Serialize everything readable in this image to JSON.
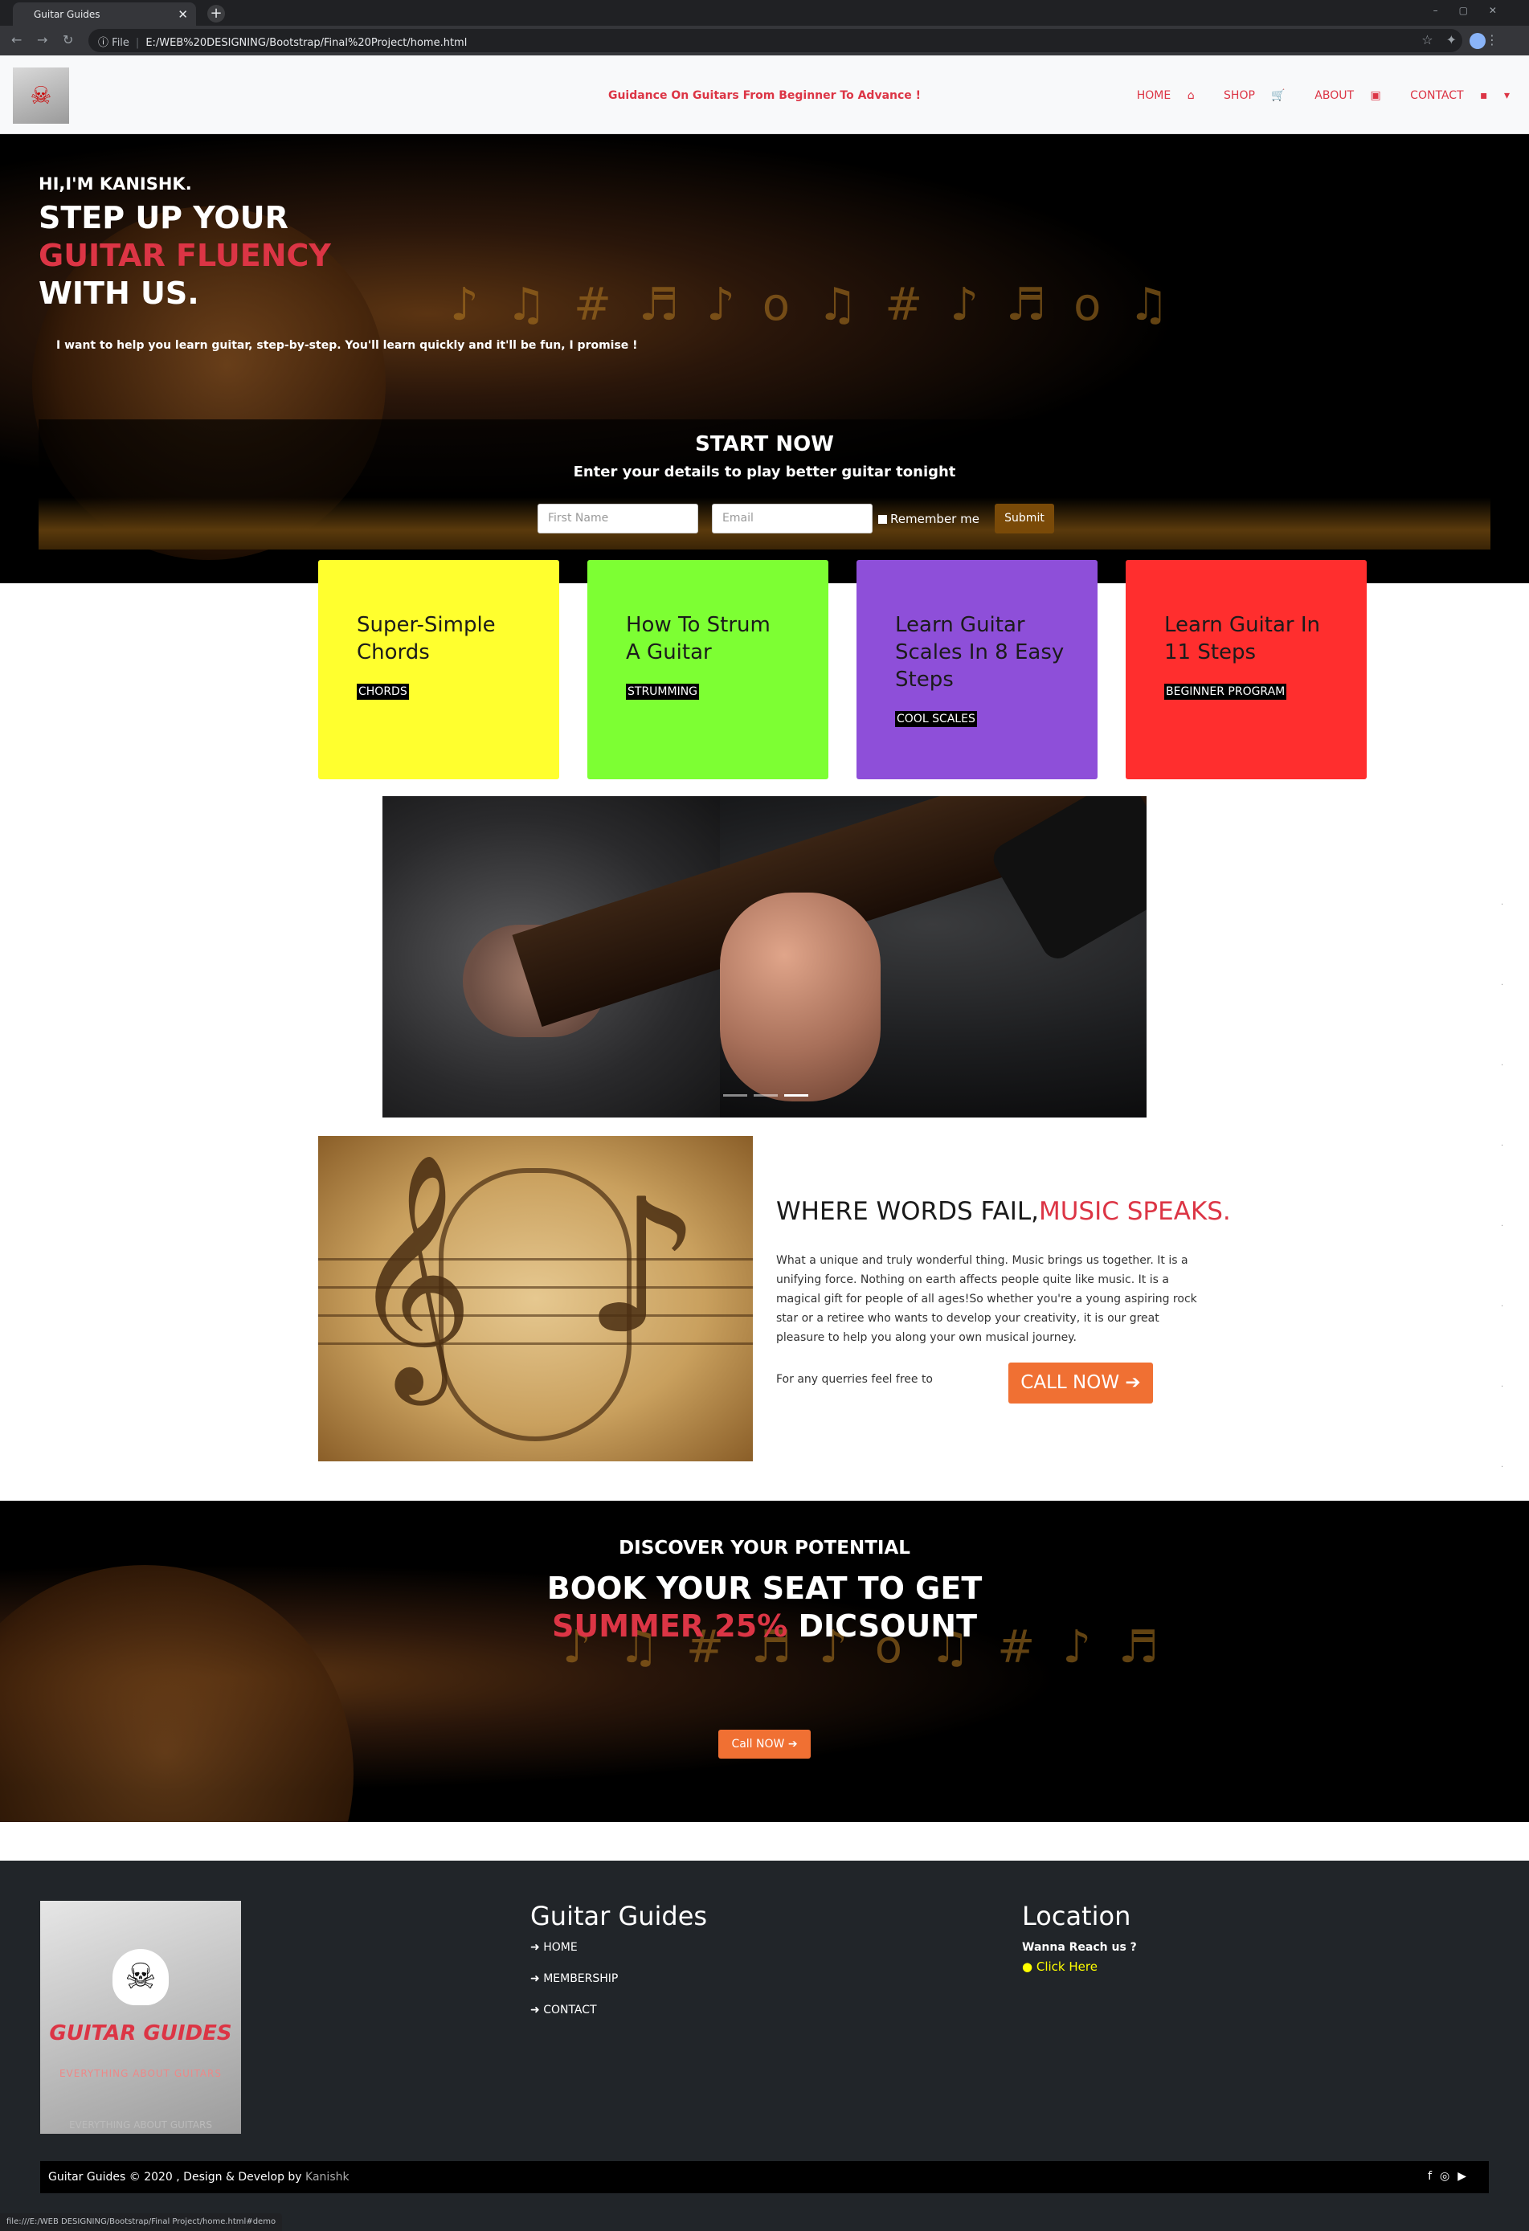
{
  "browser": {
    "tab_title": "Guitar Guides",
    "address": "E:/WEB%20DESIGNING/Bootstrap/Final%20Project/home.html",
    "address_prefix": "File",
    "status_url": "file:///E:/WEB DESIGNING/Bootstrap/Final Project/home.html#demo"
  },
  "nav": {
    "tagline": "Guidance On Guitars From Beginner To Advance !",
    "links": [
      "HOME",
      "SHOP",
      "ABOUT",
      "CONTACT"
    ]
  },
  "hero": {
    "greeting": "HI,I'M KANISHK.",
    "line1": "STEP UP YOUR",
    "line2": "GUITAR FLUENCY",
    "line3": "WITH US.",
    "subtext": "I want to help you learn guitar, step-by-step. You'll learn quickly and it'll be fun, I promise !",
    "form_title": "START NOW",
    "form_subtitle": "Enter your details to play better guitar tonight",
    "first_name_placeholder": "First Name",
    "email_placeholder": "Email",
    "remember_label": "Remember me",
    "submit_label": "Submit"
  },
  "cards": [
    {
      "title_line1": "Super-Simple",
      "title_line2": "Chords",
      "title_line3": "",
      "tag": "CHORDS",
      "color": "#ffff2e"
    },
    {
      "title_line1": "How To Strum",
      "title_line2": "A Guitar",
      "title_line3": "",
      "tag": "STRUMMING",
      "color": "#7dff33"
    },
    {
      "title_line1": "Learn Guitar",
      "title_line2": "Scales In 8 Easy",
      "title_line3": "Steps",
      "tag": "COOL SCALES",
      "color": "#8e4fd9"
    },
    {
      "title_line1": "Learn Guitar In",
      "title_line2": "11 Steps",
      "title_line3": "",
      "tag": "BEGINNER PROGRAM",
      "color": "#ff2e2e"
    }
  ],
  "music": {
    "heading": "WHERE WORDS FAIL,",
    "heading_red": "MUSIC SPEAKS.",
    "paragraph": "What a unique and truly wonderful thing. Music brings us together. It is a unifying force. Nothing on earth affects people quite like music. It is a magical gift for people of all ages!So whether you're a young aspiring rock star or a retiree who wants to develop your creativity, it is our great pleasure to help you along your own musical journey.",
    "query_text": "For any querries feel free to",
    "call_label": "CALL NOW"
  },
  "promo": {
    "line1": "DISCOVER YOUR POTENTIAL",
    "line2": "BOOK YOUR SEAT TO GET",
    "line3_red": "SUMMER 25%",
    "line3_rest": " DICSOUNT",
    "button": "Call NOW"
  },
  "footer": {
    "logo_brand": "GUITAR GUIDES",
    "logo_sub": "EVERYTHING ABOUT GUITARS",
    "col2_title": "Guitar Guides",
    "links": [
      "HOME",
      "MEMBERSHIP",
      "CONTACT"
    ],
    "col3_title": "Location",
    "wanna": "Wanna Reach us ?",
    "click": "Click Here",
    "copyright": "Guitar Guides © 2020 , Design & Develop by",
    "author": "Kanishk"
  },
  "colors": {
    "accent": "#dc3545",
    "orange": "#f07033",
    "footer_bg": "#212529"
  }
}
